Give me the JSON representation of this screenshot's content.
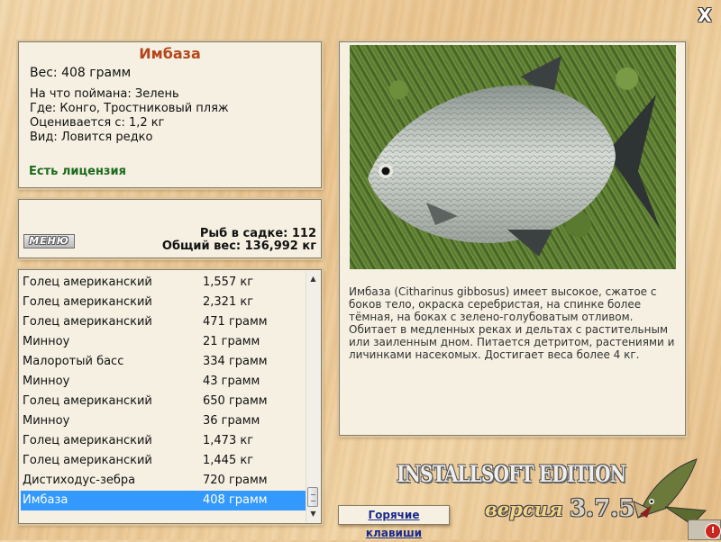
{
  "window": {
    "close_glyph": "X"
  },
  "fish_info": {
    "title": "Имбаза",
    "weight": "Вес: 408 грамм",
    "details": [
      "На что поймана: Зелень",
      "Где: Конго, Тростниковый пляж",
      "Оценивается с: 1,2 кг",
      "Вид: Ловится редко"
    ],
    "license": "Есть лицензия"
  },
  "stats": {
    "menu_label": "МЕНЮ",
    "fish_count": "Рыб в садке: 112",
    "total_weight": "Общий вес: 136,992 кг"
  },
  "catch_list": [
    {
      "name": "Голец американский",
      "weight": "1,557 кг"
    },
    {
      "name": "Голец американский",
      "weight": "2,321 кг"
    },
    {
      "name": "Голец американский",
      "weight": "471 грамм"
    },
    {
      "name": "Минноу",
      "weight": "21 грамм"
    },
    {
      "name": "Малоротый басс",
      "weight": "334 грамм"
    },
    {
      "name": "Минноу",
      "weight": "43 грамм"
    },
    {
      "name": "Голец американский",
      "weight": "650 грамм"
    },
    {
      "name": "Минноу",
      "weight": "36 грамм"
    },
    {
      "name": "Голец американский",
      "weight": "1,473 кг"
    },
    {
      "name": "Голец американский",
      "weight": "1,445 кг"
    },
    {
      "name": "Дистиходус-зебра",
      "weight": "720 грамм"
    },
    {
      "name": "Имбаза",
      "weight": "408 грамм",
      "selected": true
    }
  ],
  "description": "Имбаза (Citharinus gibbosus) имеет высокое, сжатое с боков тело, окраска серебристая, на спинке более тёмная, на боках с зелено-голубоватым отливом. Обитает в медленных реках и дельтах с растительным или заиленным дном. Питается детритом, растениями и личинками насекомых. Достигает веса более 4 кг.",
  "hotkeys_label": "Горячие клавиши",
  "brand": {
    "edition": "INSTALLSOFT EDITION",
    "version_word": "версия",
    "version_number": "3.7.5"
  },
  "colors": {
    "title": "#b5461b",
    "license": "#1d6a1d",
    "selection": "#3399ff",
    "panel_bg": "#f5f0e2"
  },
  "icons": {
    "close": "close-icon",
    "scroll_up": "scroll-up-icon",
    "scroll_down": "scroll-down-icon",
    "pike_logo": "pike-fish-icon",
    "tray": "alert-icon"
  }
}
